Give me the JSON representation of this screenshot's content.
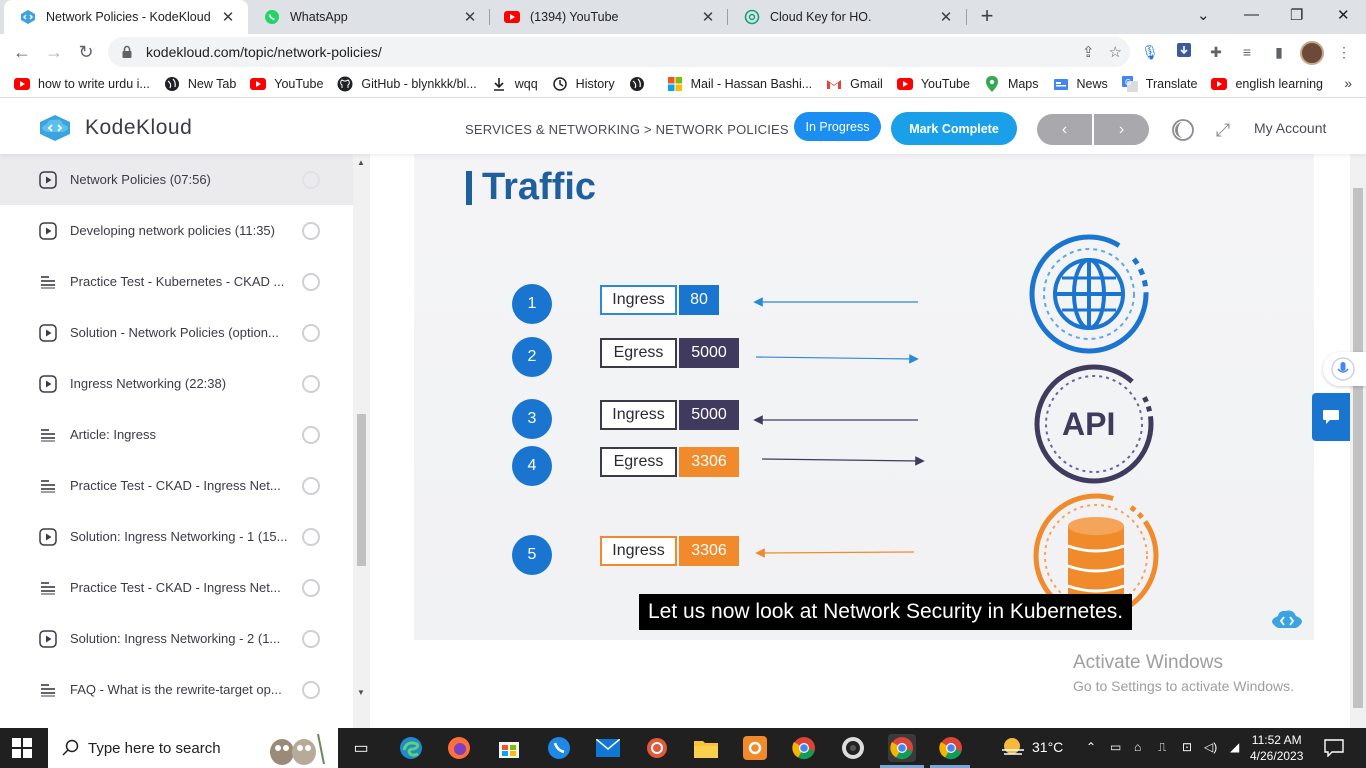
{
  "browser": {
    "tabs": [
      {
        "title": "Network Policies - KodeKloud",
        "icon": "kodekloud-icon"
      },
      {
        "title": "WhatsApp",
        "icon": "whatsapp-icon"
      },
      {
        "title": "(1394) YouTube",
        "icon": "youtube-icon"
      },
      {
        "title": "Cloud Key for HO.",
        "icon": "openai-icon"
      }
    ],
    "url": "kodekloud.com/topic/network-policies/",
    "bookmarks": [
      {
        "label": "how to write urdu i...",
        "icon": "youtube-icon"
      },
      {
        "label": "New Tab",
        "icon": "globe-icon"
      },
      {
        "label": "YouTube",
        "icon": "youtube-icon"
      },
      {
        "label": "GitHub - blynkkk/bl...",
        "icon": "github-icon"
      },
      {
        "label": "wqq",
        "icon": "download-icon"
      },
      {
        "label": "History",
        "icon": "history-icon"
      },
      {
        "label": "",
        "icon": "globe-icon"
      },
      {
        "label": "Mail - Hassan Bashi...",
        "icon": "microsoft-icon"
      },
      {
        "label": "Gmail",
        "icon": "gmail-icon"
      },
      {
        "label": "YouTube",
        "icon": "youtube-icon"
      },
      {
        "label": "Maps",
        "icon": "maps-icon"
      },
      {
        "label": "News",
        "icon": "news-icon"
      },
      {
        "label": "Translate",
        "icon": "translate-icon"
      },
      {
        "label": "english learning",
        "icon": "youtube-icon"
      }
    ],
    "more_bookmarks": "»"
  },
  "header": {
    "logo_text": "KodeKloud",
    "breadcrumb": "SERVICES & NETWORKING > NETWORK POLICIES",
    "status_button": "In Progress",
    "complete_button": "Mark Complete",
    "prev": "‹",
    "next": "›",
    "account": "My Account"
  },
  "sidebar": {
    "lessons": [
      {
        "title": "Network Policies (07:56)",
        "type": "video",
        "current": true
      },
      {
        "title": "Developing network policies (11:35)",
        "type": "video"
      },
      {
        "title": "Practice Test - Kubernetes - CKAD ...",
        "type": "lab"
      },
      {
        "title": "Solution - Network Policies (option...",
        "type": "video"
      },
      {
        "title": "Ingress Networking (22:38)",
        "type": "video"
      },
      {
        "title": "Article: Ingress",
        "type": "lab"
      },
      {
        "title": "Practice Test - CKAD - Ingress Net...",
        "type": "lab"
      },
      {
        "title": "Solution: Ingress Networking - 1 (15...",
        "type": "video"
      },
      {
        "title": "Practice Test - CKAD - Ingress Net...",
        "type": "lab"
      },
      {
        "title": "Solution: Ingress Networking - 2 (1...",
        "type": "video"
      },
      {
        "title": "FAQ - What is the rewrite-target op...",
        "type": "lab"
      }
    ]
  },
  "slide": {
    "title": "Traffic",
    "rules": [
      {
        "num": "1",
        "direction": "Ingress",
        "port": "80",
        "port_color": "#1a75d1"
      },
      {
        "num": "2",
        "direction": "Egress",
        "port": "5000",
        "port_color": "#3f3a5e"
      },
      {
        "num": "3",
        "direction": "Ingress",
        "port": "5000",
        "port_color": "#3f3a5e"
      },
      {
        "num": "4",
        "direction": "Egress",
        "port": "3306",
        "port_color": "#f08a2a"
      },
      {
        "num": "5",
        "direction": "Ingress",
        "port": "3306",
        "port_color": "#f08a2a"
      }
    ],
    "api_label": "API",
    "caption": "Let us now look at Network Security in Kubernetes."
  },
  "watermark": {
    "line1": "Activate Windows",
    "line2": "Go to Settings to activate Windows."
  },
  "taskbar": {
    "search_placeholder": "Type here to search",
    "weather": "31°C",
    "time": "11:52 AM",
    "date": "4/26/2023"
  }
}
